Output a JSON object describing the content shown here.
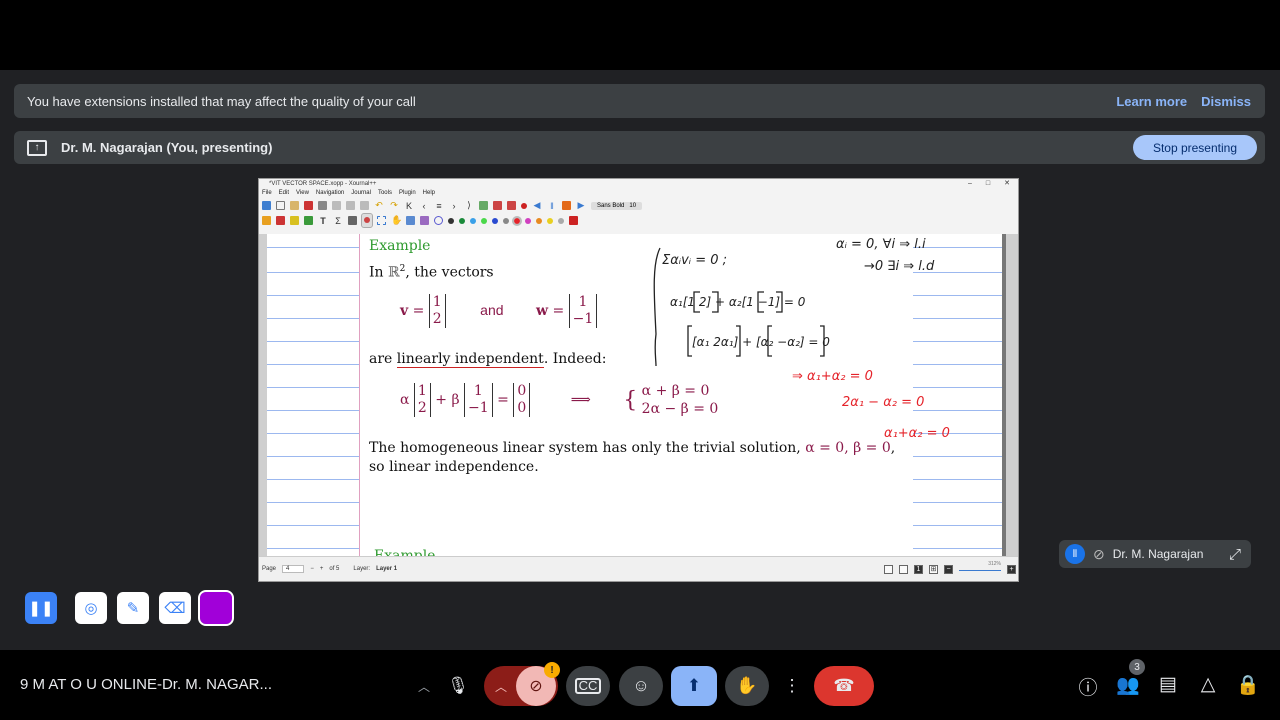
{
  "banner": {
    "message": "You have extensions installed that may affect the quality of your call",
    "learn_more": "Learn more",
    "dismiss": "Dismiss"
  },
  "presenting": {
    "label": "Dr. M. Nagarajan (You, presenting)",
    "stop_button": "Stop presenting"
  },
  "xournal": {
    "title": "*VIT VECTOR SPACE.xopp - Xournal++",
    "menu": [
      "File",
      "Edit",
      "View",
      "Navigation",
      "Journal",
      "Tools",
      "Plugin",
      "Help"
    ],
    "font_name": "Sans Bold",
    "font_size": "10",
    "status": {
      "page_label": "Page",
      "page_value": "4",
      "of_pages": "of 5",
      "layer_label": "Layer:",
      "layer_value": "Layer 1",
      "zoom": "312%"
    }
  },
  "slide": {
    "heading": "Example",
    "line1_pre": "In ",
    "line1_r": "ℝ",
    "line1_sup": "2",
    "line1_post": ", the vectors",
    "v_label": "v",
    "eq": "=",
    "v_values": [
      "1",
      "2"
    ],
    "and": "and",
    "w_label": "w",
    "w_values": [
      "1",
      "−1"
    ],
    "line3_pre": "are ",
    "line3_underlined": "linearly independent",
    "line3_post": ". Indeed:",
    "alpha": "α",
    "plus": "+",
    "beta": "β",
    "zero_vec": [
      "0",
      "0"
    ],
    "implies": "⟹",
    "system": [
      "α + β = 0",
      "2α − β = 0"
    ],
    "conclusion_pre": "The homogeneous linear system has only the trivial solution, ",
    "conclusion_math": "α = 0, β = 0",
    "conclusion_end": ",",
    "conclusion2": "so linear independence.",
    "next_heading": "Example"
  },
  "handwriting": [
    "Σαᵢvᵢ = 0 ;",
    "αᵢ = 0, ∀i ⇒ l.i",
    "→0  ∃i ⇒ l.d",
    "α₁[1 2] + α₂[1 −1] = 0",
    "[α₁ 2α₁] + [α₂ −α₂] = 0",
    "⇒ α₁+α₂ = 0",
    "2α₁ − α₂ = 0",
    "α₁+α₂ = 0"
  ],
  "self_tile": {
    "name": "Dr. M. Nagarajan"
  },
  "meeting": {
    "title": "9 M  AT  O  U  ONLINE-Dr. M. NAGAR...",
    "participants_count": "3",
    "warning_badge": "!"
  },
  "colors": {
    "accent_blue": "#a8c7fa",
    "end_call": "#dc362e",
    "present_active": "#8ab4f8",
    "ink_red": "#e5232a",
    "slide_maroon": "#8a1a4a",
    "slide_green": "#2e9a2e",
    "annotation_purple": "#a100d9"
  },
  "icons": [
    "present-screen-icon",
    "microphone-icon",
    "camera-off-icon",
    "captions-icon",
    "emoji-icon",
    "present-icon",
    "raise-hand-icon",
    "more-icon",
    "hang-up-icon",
    "info-icon",
    "people-icon",
    "chat-icon",
    "activities-icon",
    "host-controls-icon",
    "pause-icon",
    "spotlight-icon",
    "pen-icon",
    "eraser-icon",
    "expand-icon"
  ]
}
